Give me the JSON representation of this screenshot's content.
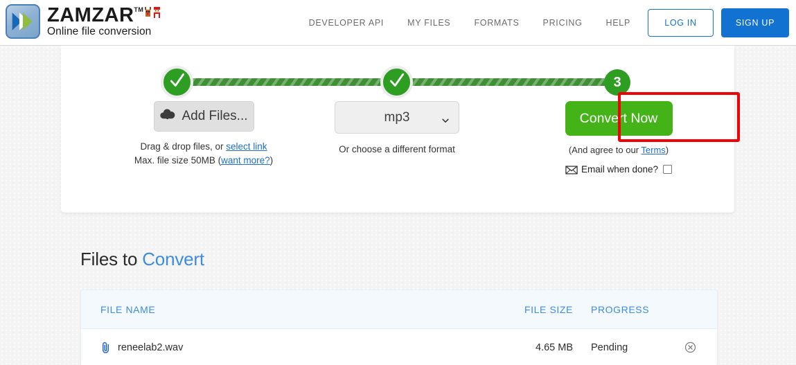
{
  "header": {
    "logo": {
      "word": "ZAMZAR",
      "tm": "TM",
      "tagline": "Online file conversion",
      "mark_icon": "double-chevron-logo-icon",
      "decor_icon": "holiday-characters-icon"
    },
    "nav_items": [
      {
        "label": "DEVELOPER API"
      },
      {
        "label": "MY FILES"
      },
      {
        "label": "FORMATS"
      },
      {
        "label": "PRICING"
      },
      {
        "label": "HELP"
      }
    ],
    "login_label": "LOG IN",
    "signup_label": "SIGN UP"
  },
  "steps": {
    "step1_icon": "check-icon",
    "step2_icon": "check-icon",
    "step3_number": "3"
  },
  "step1": {
    "button_label": "Add Files...",
    "button_icon": "cloud-upload-icon",
    "hint_prefix": "Drag & drop files, or ",
    "hint_link": "select link",
    "limit_prefix": "Max. file size 50MB (",
    "limit_link": "want more?",
    "limit_suffix": ")"
  },
  "step2": {
    "selected_format": "mp3",
    "caption": "Or choose a different format",
    "chevron_icon": "chevron-down-icon"
  },
  "step3": {
    "convert_label": "Convert Now",
    "terms_prefix": "(And agree to our ",
    "terms_link": "Terms",
    "terms_suffix": ")",
    "email_icon": "envelope-icon",
    "email_label": "Email when done?",
    "email_checked": false,
    "highlight_color": "#f00306"
  },
  "files_section": {
    "title_plain": "Files to ",
    "title_accent": "Convert",
    "columns": {
      "name": "FILE NAME",
      "size": "FILE SIZE",
      "progress": "PROGRESS"
    },
    "rows": [
      {
        "file_icon": "paperclip-icon",
        "name": "reneelab2.wav",
        "size": "4.65 MB",
        "progress": "Pending",
        "remove_icon": "remove-circle-icon"
      }
    ]
  },
  "colors": {
    "brand_blue": "#1272d2",
    "accent_blue": "#3c8ce2",
    "step_green": "#2e9e23",
    "convert_green": "#44b318",
    "highlight_red": "#f00306"
  }
}
